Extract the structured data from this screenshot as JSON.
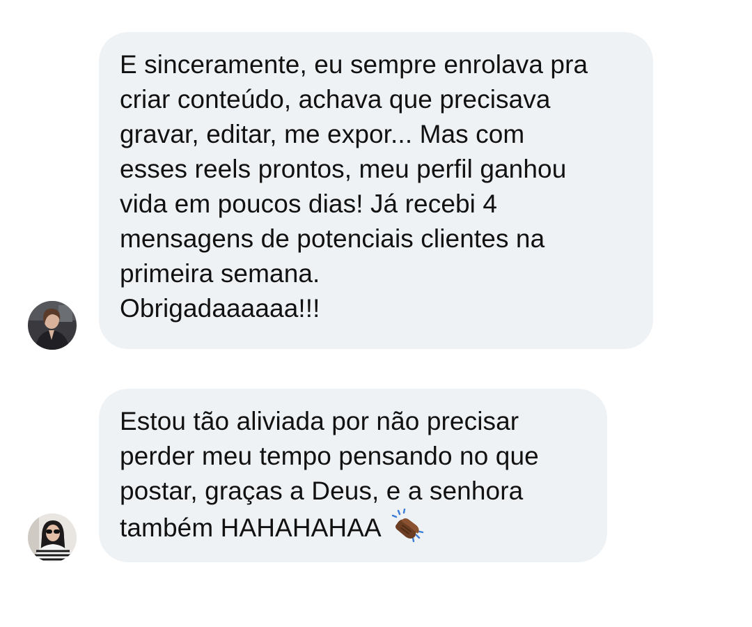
{
  "conversation": {
    "messages": [
      {
        "lines": [
          "E sinceramente, eu sempre enrolava pra",
          "criar conteúdo, achava que precisava",
          "gravar, editar, me expor... Mas com",
          "esses reels prontos, meu perfil ganhou",
          "vida em poucos dias! Já recebi 4",
          "mensagens de potenciais clientes na",
          "primeira semana.",
          "Obrigadaaaaaa!!!"
        ],
        "avatar": "user-avatar-1"
      },
      {
        "lines": [
          "Estou tão aliviada por não precisar",
          "perder meu tempo pensando no que",
          "postar, graças a Deus, e a senhora",
          "também HAHAHAHAA"
        ],
        "emoji": "clapping-hands-icon",
        "avatar": "user-avatar-2"
      }
    ]
  },
  "colors": {
    "bubble_background": "#eff2f5",
    "text": "#111111",
    "page_background": "#ffffff"
  }
}
